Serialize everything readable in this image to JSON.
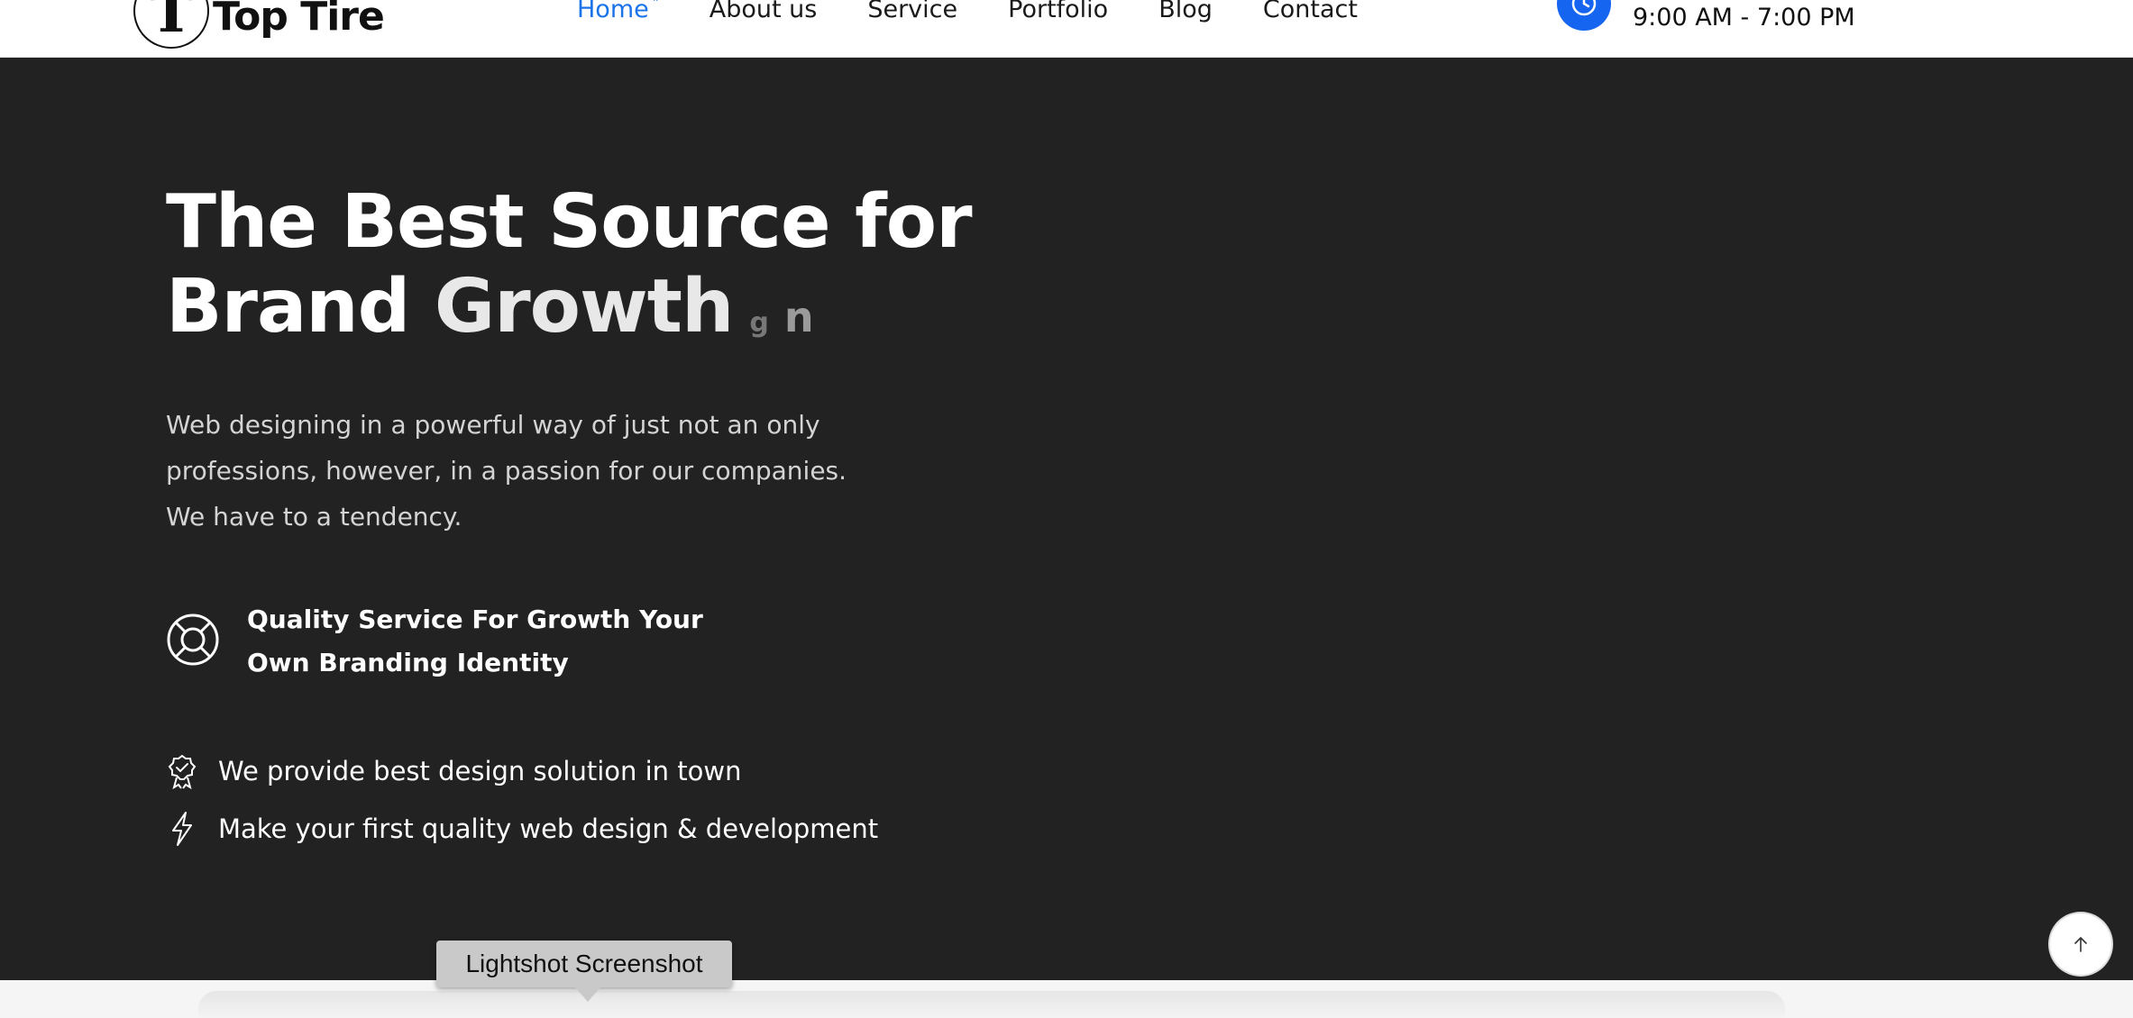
{
  "header": {
    "logo_text": "Top Tire",
    "nav": [
      {
        "label": "Home",
        "active": true
      },
      {
        "label": "About us"
      },
      {
        "label": "Service"
      },
      {
        "label": "Portfolio"
      },
      {
        "label": "Blog"
      },
      {
        "label": "Contact"
      }
    ],
    "hours": "9:00 AM - 7:00 PM",
    "hours_icon": "clock-icon",
    "accent_color": "#1565f0"
  },
  "hero": {
    "title_line1": "The Best Source for",
    "title_line2_prefix": "Brand ",
    "title_animated": "Growth",
    "title_ghost_1": "g",
    "title_ghost_2": "n",
    "description": "Web designing in a powerful way of just not an only professions, however, in a passion for our companies. We have to a tendency.",
    "feature_icon": "lifebuoy-icon",
    "feature_text": "Quality Service For Growth Your Own Branding Identity",
    "bullets": [
      {
        "icon": "award-badge-icon",
        "text": "We provide best design solution in town"
      },
      {
        "icon": "lightning-icon",
        "text": "Make your first quality web design & development"
      }
    ]
  },
  "overlay": {
    "tooltip": "Lightshot Screenshot",
    "scroll_top_icon": "arrow-up-icon"
  },
  "colors": {
    "background": "#222222",
    "header_bg": "#ffffff",
    "accent": "#1a73e8"
  }
}
